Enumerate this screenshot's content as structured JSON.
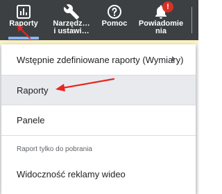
{
  "toolbar": {
    "items": [
      {
        "label": "Raporty",
        "icon": "bar-chart-icon",
        "active": true
      },
      {
        "label": "Narzędz…\ni ustawi…",
        "icon": "wrench-icon"
      },
      {
        "label": "Pomoc",
        "icon": "help-circle-icon"
      },
      {
        "label": "Powiadomie\nnia",
        "icon": "bell-icon",
        "badge": "!"
      }
    ]
  },
  "menu": {
    "predefined_label": "Wstępnie zdefiniowane raporty (Wymiary)",
    "reports_label": "Raporty",
    "dashboards_label": "Panele",
    "section_label": "Raport tylko do pobrania",
    "video_label": "Widoczność reklamy wideo"
  },
  "colors": {
    "toolbar_bg": "#3c4043",
    "active_underline": "#8ab4f8",
    "badge": "#d93025",
    "annotation_arrow": "#e8261f",
    "highlight_row": "#e8eaed"
  }
}
